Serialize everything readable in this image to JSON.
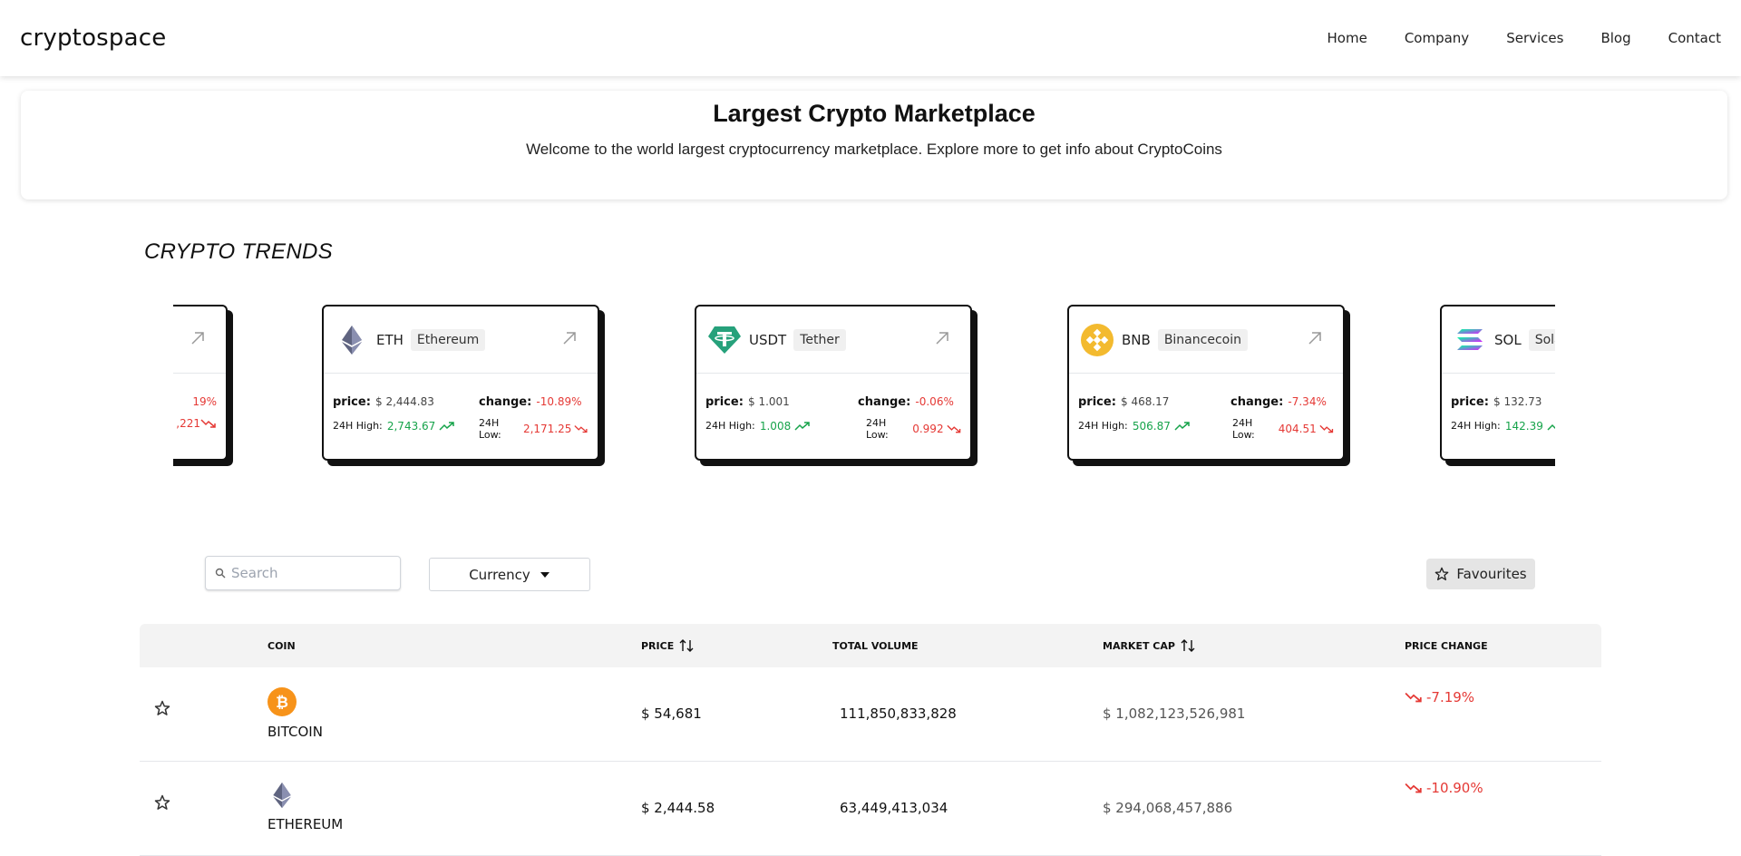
{
  "navbar": {
    "brand": "cryptospace",
    "links": [
      "Home",
      "Company",
      "Services",
      "Blog",
      "Contact"
    ]
  },
  "hero": {
    "title": "Largest Crypto Marketplace",
    "subtitle": "Welcome to the world largest cryptocurrency marketplace. Explore more to get info about CryptoCoins"
  },
  "trends": {
    "title": "CRYPTO TRENDS",
    "partial_left": {
      "change": "19%",
      "low": ",221"
    },
    "cards": [
      {
        "symbol": "ETH",
        "name": "Ethereum",
        "price_label": "price:",
        "price": "$ 2,444.83",
        "change_label": "change:",
        "change": "-10.89%",
        "high_label": "24H High:",
        "high": "2,743.67",
        "low_label": "24H Low:",
        "low": "2,171.25",
        "icon": "ethereum-logo-icon"
      },
      {
        "symbol": "USDT",
        "name": "Tether",
        "price_label": "price:",
        "price": "$ 1.001",
        "change_label": "change:",
        "change": "-0.06%",
        "high_label": "24H High:",
        "high": "1.008",
        "low_label": "24H Low:",
        "low": "0.992",
        "icon": "tether-logo-icon"
      },
      {
        "symbol": "BNB",
        "name": "Binancecoin",
        "price_label": "price:",
        "price": "$ 468.17",
        "change_label": "change:",
        "change": "-7.34%",
        "high_label": "24H High:",
        "high": "506.87",
        "low_label": "24H Low:",
        "low": "404.51",
        "icon": "binance-logo-icon"
      },
      {
        "symbol": "SOL",
        "name": "Sola",
        "price_label": "price:",
        "price": "$ 132.73",
        "high_label": "24H High:",
        "high": "142.39",
        "icon": "solana-logo-icon"
      }
    ]
  },
  "controls": {
    "search_placeholder": "Search",
    "currency_label": "Currency",
    "favourites_label": "Favourites"
  },
  "table": {
    "headers": {
      "coin": "COIN",
      "price": "PRICE",
      "volume": "TOTAL VOLUME",
      "market_cap": "MARKET CAP",
      "price_change": "PRICE CHANGE"
    },
    "rows": [
      {
        "name": "BITCOIN",
        "price": "$ 54,681",
        "volume": "111,850,833,828",
        "market_cap": "$ 1,082,123,526,981",
        "change": "-7.19%",
        "icon": "bitcoin-logo-icon"
      },
      {
        "name": "ETHEREUM",
        "price": "$ 2,444.58",
        "volume": "63,449,413,034",
        "market_cap": "$ 294,068,457,886",
        "change": "-10.90%",
        "icon": "ethereum-logo-icon"
      }
    ]
  },
  "colors": {
    "negative": "#e53935",
    "positive": "#16a34a",
    "card_shadow": "#111111",
    "table_header_bg": "#f3f3f3"
  }
}
